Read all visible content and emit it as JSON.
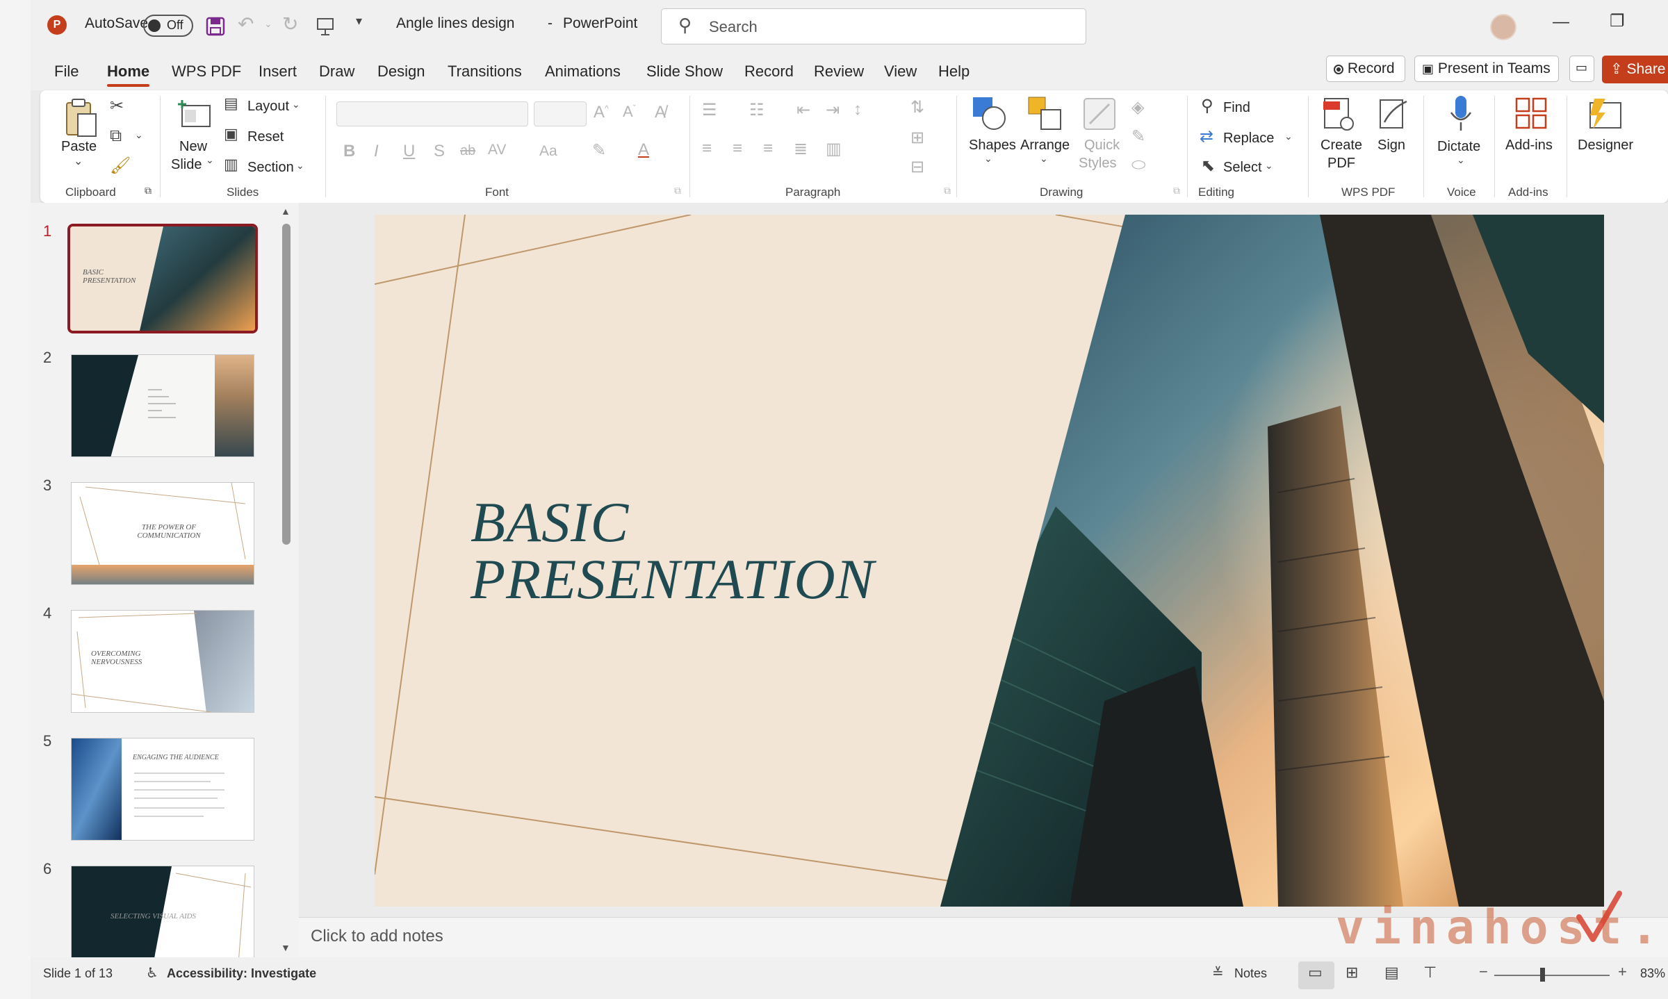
{
  "app": {
    "autosave_label": "AutoSave",
    "autosave_state": "Off",
    "document_title": "Angle lines design",
    "separator": "-",
    "app_name": "PowerPoint",
    "search_placeholder": "Search"
  },
  "menu": {
    "tabs": [
      "File",
      "Home",
      "WPS PDF",
      "Insert",
      "Draw",
      "Design",
      "Transitions",
      "Animations",
      "Slide Show",
      "Record",
      "Review",
      "View",
      "Help"
    ],
    "active_tab": "Home",
    "record_btn": "Record",
    "present_btn": "Present in Teams",
    "share_btn": "Share"
  },
  "ribbon": {
    "clipboard": {
      "paste": "Paste",
      "group": "Clipboard"
    },
    "slides": {
      "new_slide_1": "New",
      "new_slide_2": "Slide",
      "layout": "Layout",
      "reset": "Reset",
      "section": "Section",
      "group": "Slides"
    },
    "font": {
      "group": "Font",
      "bold": "B",
      "italic": "I",
      "underline": "U",
      "shadow": "S",
      "strike": "ab",
      "spacing": "AV",
      "case": "Aa"
    },
    "paragraph": {
      "group": "Paragraph"
    },
    "drawing": {
      "shapes": "Shapes",
      "arrange": "Arrange",
      "quick_1": "Quick",
      "quick_2": "Styles",
      "group": "Drawing"
    },
    "editing": {
      "find": "Find",
      "replace": "Replace",
      "select": "Select",
      "group": "Editing"
    },
    "wps": {
      "create_1": "Create",
      "create_2": "PDF",
      "sign": "Sign",
      "group": "WPS PDF"
    },
    "voice": {
      "dictate": "Dictate",
      "group": "Voice"
    },
    "addins": {
      "addins": "Add-ins",
      "group": "Add-ins"
    },
    "designer": {
      "designer": "Designer"
    }
  },
  "thumbnails": [
    {
      "num": "1",
      "text": "BASIC PRESENTATION"
    },
    {
      "num": "2",
      "text": ""
    },
    {
      "num": "3",
      "text": "THE POWER OF COMMUNICATION"
    },
    {
      "num": "4",
      "text": "OVERCOMING NERVOUSNESS"
    },
    {
      "num": "5",
      "text": "ENGAGING THE AUDIENCE"
    },
    {
      "num": "6",
      "text": "SELECTING VISUAL AIDS"
    }
  ],
  "slide": {
    "title_line1": "BASIC",
    "title_line2": "PRESENTATION"
  },
  "notes_placeholder": "Click to add notes",
  "status": {
    "slide_info": "Slide 1 of 13",
    "accessibility": "Accessibility: Investigate",
    "notes": "Notes",
    "zoom": "83%",
    "zoom_level": 0.83
  },
  "watermark": "vinahost."
}
